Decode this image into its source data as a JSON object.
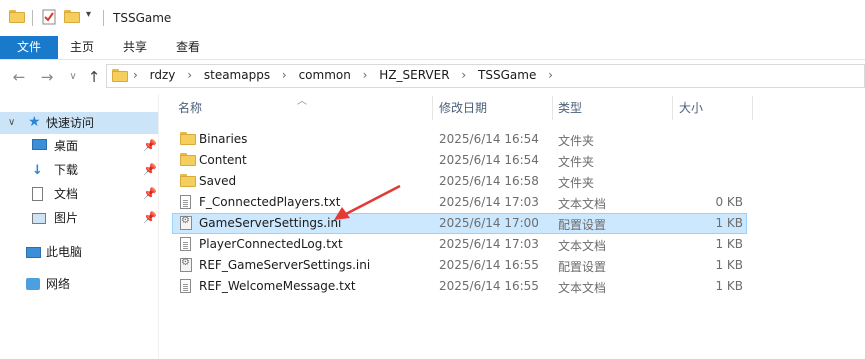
{
  "window": {
    "title": "TSSGame"
  },
  "ribbon": {
    "tabs": [
      "文件",
      "主页",
      "共享",
      "查看"
    ]
  },
  "address": {
    "crumbs": [
      "rdzy",
      "steamapps",
      "common",
      "HZ_SERVER",
      "TSSGame"
    ]
  },
  "sidebar": {
    "items": [
      {
        "label": "快速访问",
        "icon": "star-icon",
        "active": true,
        "pinned": false
      },
      {
        "label": "桌面",
        "icon": "desktop-icon",
        "active": false,
        "pinned": true
      },
      {
        "label": "下载",
        "icon": "download-icon",
        "active": false,
        "pinned": true
      },
      {
        "label": "文档",
        "icon": "document-icon",
        "active": false,
        "pinned": true
      },
      {
        "label": "图片",
        "icon": "picture-icon",
        "active": false,
        "pinned": true
      },
      {
        "label": "此电脑",
        "icon": "computer-icon",
        "active": false,
        "pinned": false
      },
      {
        "label": "网络",
        "icon": "network-icon",
        "active": false,
        "pinned": false
      }
    ]
  },
  "columns": {
    "name": "名称",
    "date": "修改日期",
    "type": "类型",
    "size": "大小"
  },
  "files": [
    {
      "name": "Binaries",
      "date": "2025/6/14 16:54",
      "type": "文件夹",
      "size": "",
      "icon": "folder-icon"
    },
    {
      "name": "Content",
      "date": "2025/6/14 16:54",
      "type": "文件夹",
      "size": "",
      "icon": "folder-icon"
    },
    {
      "name": "Saved",
      "date": "2025/6/14 16:58",
      "type": "文件夹",
      "size": "",
      "icon": "folder-icon"
    },
    {
      "name": "F_ConnectedPlayers.txt",
      "date": "2025/6/14 17:03",
      "type": "文本文档",
      "size": "0 KB",
      "icon": "text-file-icon"
    },
    {
      "name": "GameServerSettings.ini",
      "date": "2025/6/14 17:00",
      "type": "配置设置",
      "size": "1 KB",
      "icon": "ini-file-icon",
      "selected": true
    },
    {
      "name": "PlayerConnectedLog.txt",
      "date": "2025/6/14 17:03",
      "type": "文本文档",
      "size": "1 KB",
      "icon": "text-file-icon"
    },
    {
      "name": "REF_GameServerSettings.ini",
      "date": "2025/6/14 16:55",
      "type": "配置设置",
      "size": "1 KB",
      "icon": "ini-file-icon"
    },
    {
      "name": "REF_WelcomeMessage.txt",
      "date": "2025/6/14 16:55",
      "type": "文本文档",
      "size": "1 KB",
      "icon": "text-file-icon"
    }
  ],
  "colors": {
    "accent": "#1979ca",
    "selection": "#cce8ff",
    "annotation_arrow": "#e53935"
  }
}
